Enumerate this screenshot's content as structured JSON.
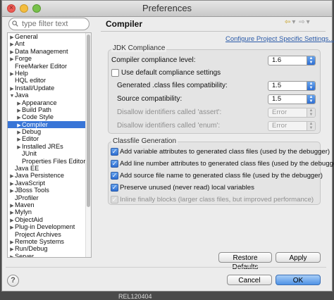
{
  "window": {
    "title": "Preferences"
  },
  "search": {
    "placeholder": "type filter text"
  },
  "tree": {
    "items": [
      {
        "label": "General",
        "indent": 0,
        "twisty": "right"
      },
      {
        "label": "Ant",
        "indent": 0,
        "twisty": "right"
      },
      {
        "label": "Data Management",
        "indent": 0,
        "twisty": "right"
      },
      {
        "label": "Forge",
        "indent": 0,
        "twisty": "right"
      },
      {
        "label": "FreeMarker Editor",
        "indent": 0,
        "twisty": ""
      },
      {
        "label": "Help",
        "indent": 0,
        "twisty": "right"
      },
      {
        "label": "HQL editor",
        "indent": 0,
        "twisty": ""
      },
      {
        "label": "Install/Update",
        "indent": 0,
        "twisty": "right"
      },
      {
        "label": "Java",
        "indent": 0,
        "twisty": "down"
      },
      {
        "label": "Appearance",
        "indent": 1,
        "twisty": "right"
      },
      {
        "label": "Build Path",
        "indent": 1,
        "twisty": "right"
      },
      {
        "label": "Code Style",
        "indent": 1,
        "twisty": "right"
      },
      {
        "label": "Compiler",
        "indent": 1,
        "twisty": "right",
        "selected": true
      },
      {
        "label": "Debug",
        "indent": 1,
        "twisty": "right"
      },
      {
        "label": "Editor",
        "indent": 1,
        "twisty": "right"
      },
      {
        "label": "Installed JREs",
        "indent": 1,
        "twisty": "right"
      },
      {
        "label": "JUnit",
        "indent": 1,
        "twisty": ""
      },
      {
        "label": "Properties Files Editor",
        "indent": 1,
        "twisty": ""
      },
      {
        "label": "Java EE",
        "indent": 0,
        "twisty": ""
      },
      {
        "label": "Java Persistence",
        "indent": 0,
        "twisty": "right"
      },
      {
        "label": "JavaScript",
        "indent": 0,
        "twisty": "right"
      },
      {
        "label": "JBoss Tools",
        "indent": 0,
        "twisty": "right"
      },
      {
        "label": "JProfiler",
        "indent": 0,
        "twisty": ""
      },
      {
        "label": "Maven",
        "indent": 0,
        "twisty": "right"
      },
      {
        "label": "Mylyn",
        "indent": 0,
        "twisty": "right"
      },
      {
        "label": "ObjectAid",
        "indent": 0,
        "twisty": "right"
      },
      {
        "label": "Plug-in Development",
        "indent": 0,
        "twisty": "right"
      },
      {
        "label": "Project Archives",
        "indent": 0,
        "twisty": ""
      },
      {
        "label": "Remote Systems",
        "indent": 0,
        "twisty": "right"
      },
      {
        "label": "Run/Debug",
        "indent": 0,
        "twisty": "right"
      },
      {
        "label": "Server",
        "indent": 0,
        "twisty": "right"
      }
    ]
  },
  "panel": {
    "title": "Compiler",
    "configure_link": "Configure Project Specific Settings..."
  },
  "jdk": {
    "legend": "JDK Compliance",
    "compliance_label": "Compiler compliance level:",
    "compliance_value": "1.6",
    "use_default_label": "Use default compliance settings",
    "class_compat_label": "Generated .class files compatibility:",
    "class_compat_value": "1.5",
    "source_compat_label": "Source compatibility:",
    "source_compat_value": "1.5",
    "assert_label": "Disallow identifiers called 'assert':",
    "assert_value": "Error",
    "enum_label": "Disallow identifiers called 'enum':",
    "enum_value": "Error"
  },
  "classfile": {
    "legend": "Classfile Generation",
    "opt_variable": "Add variable attributes to generated class files (used by the debugger)",
    "opt_line": "Add line number attributes to generated class files (used by the debugger)",
    "opt_source": "Add source file name to generated class file (used by the debugger)",
    "opt_preserve": "Preserve unused (never read) local variables",
    "opt_inline": "Inline finally blocks (larger class files, but improved performance)"
  },
  "buttons": {
    "restore": "Restore Defaults",
    "apply": "Apply",
    "cancel": "Cancel",
    "ok": "OK",
    "help": "?"
  },
  "background": {
    "text": "REL120404"
  },
  "colors": {
    "selection": "#3875d7",
    "link": "#2a5aa8",
    "ok_button": "#4f93e6"
  }
}
